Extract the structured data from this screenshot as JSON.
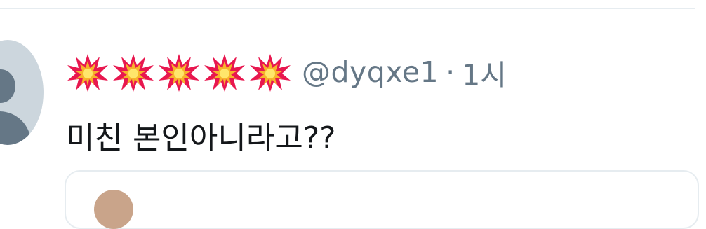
{
  "tweet": {
    "display_name_emojis": [
      "collision-icon",
      "collision-icon",
      "collision-icon",
      "collision-icon",
      "collision-icon"
    ],
    "handle": "@dyqxe1",
    "separator": "·",
    "time": "1시",
    "text": "미친 본인아니라고??"
  },
  "colors": {
    "divider": "#e6ecf0",
    "secondary_text": "#657786",
    "primary_text": "#14171a",
    "avatar_bg": "#ccd6dd",
    "avatar_fg": "#657786"
  }
}
